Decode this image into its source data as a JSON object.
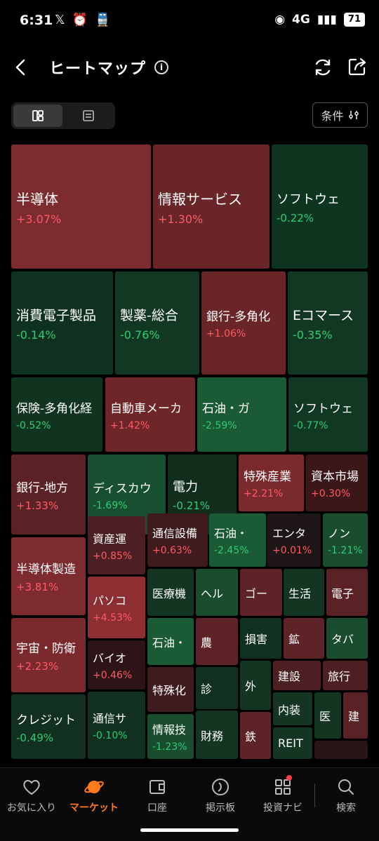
{
  "status_bar": {
    "time": "6:31",
    "network": "4G",
    "battery": "71",
    "icons": [
      "x-icon",
      "alarm-icon",
      "train-icon",
      "hotspot-icon",
      "signal-icon"
    ]
  },
  "header": {
    "title": "ヒートマップ",
    "info_icon": "info-icon",
    "back_icon": "chevron-left-icon",
    "refresh_icon": "refresh-icon",
    "share_icon": "share-icon"
  },
  "toolbar": {
    "view_options": [
      "heatmap-view-icon",
      "list-view-icon"
    ],
    "selected_view": "heatmap-view-icon",
    "filter_label": "条件"
  },
  "colors": {
    "up_text": "#ff5a66",
    "down_text": "#2fcc73",
    "accent": "#ff7a1a"
  },
  "heatmap": {
    "tiles": [
      {
        "name": "半導体",
        "change": "+3.07%"
      },
      {
        "name": "情報サービス",
        "change": "+1.30%"
      },
      {
        "name": "ソフトウェ",
        "change": "-0.22%"
      },
      {
        "name": "消費電子製品",
        "change": "-0.14%"
      },
      {
        "name": "製薬-総合",
        "change": "-0.76%"
      },
      {
        "name": "銀行-多角化",
        "change": "+1.06%"
      },
      {
        "name": "Eコマース",
        "change": "-0.35%"
      },
      {
        "name": "保険-多角化経",
        "change": "-0.52%"
      },
      {
        "name": "自動車メーカ",
        "change": "+1.42%"
      },
      {
        "name": "石油・ガ",
        "change": "-2.59%"
      },
      {
        "name": "ソフトウェ",
        "change": "-0.77%"
      },
      {
        "name": "銀行-地方",
        "change": "+1.33%"
      },
      {
        "name": "ディスカウ",
        "change": "-1.69%"
      },
      {
        "name": "電力",
        "change": "-0.21%"
      },
      {
        "name": "特殊産業",
        "change": "+2.21%"
      },
      {
        "name": "資本市場",
        "change": "+0.30%"
      },
      {
        "name": "資産運",
        "change": "+0.85%"
      },
      {
        "name": "通信設備",
        "change": "+0.63%"
      },
      {
        "name": "石油・",
        "change": "-2.45%"
      },
      {
        "name": "エンタ",
        "change": "+0.01%"
      },
      {
        "name": "ノン",
        "change": "-1.21%"
      },
      {
        "name": "半導体製造",
        "change": "+3.81%"
      },
      {
        "name": "パソコ",
        "change": "+4.53%"
      },
      {
        "name": "医療機",
        "change": ""
      },
      {
        "name": "ヘル",
        "change": ""
      },
      {
        "name": "ゴー",
        "change": ""
      },
      {
        "name": "生活",
        "change": ""
      },
      {
        "name": "電子",
        "change": ""
      },
      {
        "name": "宇宙・防衛",
        "change": "+2.23%"
      },
      {
        "name": "バイオ",
        "change": "+0.46%"
      },
      {
        "name": "石油・",
        "change": ""
      },
      {
        "name": "農",
        "change": ""
      },
      {
        "name": "損害",
        "change": ""
      },
      {
        "name": "鉱",
        "change": ""
      },
      {
        "name": "タバ",
        "change": ""
      },
      {
        "name": "特殊化",
        "change": ""
      },
      {
        "name": "診",
        "change": ""
      },
      {
        "name": "外",
        "change": ""
      },
      {
        "name": "建設",
        "change": ""
      },
      {
        "name": "旅行",
        "change": ""
      },
      {
        "name": "クレジット",
        "change": "-0.49%"
      },
      {
        "name": "通信サ",
        "change": "-0.10%"
      },
      {
        "name": "情報技",
        "change": "-1.23%"
      },
      {
        "name": "財務",
        "change": ""
      },
      {
        "name": "鉄",
        "change": ""
      },
      {
        "name": "内装",
        "change": ""
      },
      {
        "name": "医",
        "change": ""
      },
      {
        "name": "建",
        "change": ""
      },
      {
        "name": "REIT",
        "change": ""
      },
      {
        "name": "",
        "change": ""
      }
    ]
  },
  "bottom_nav": {
    "items": [
      {
        "label": "お気に入り",
        "icon": "heart-icon"
      },
      {
        "label": "マーケット",
        "icon": "planet-icon"
      },
      {
        "label": "口座",
        "icon": "wallet-icon"
      },
      {
        "label": "掲示板",
        "icon": "board-icon"
      },
      {
        "label": "投資ナビ",
        "icon": "grid-icon"
      },
      {
        "label": "検索",
        "icon": "search-icon"
      }
    ],
    "active": "マーケット"
  }
}
